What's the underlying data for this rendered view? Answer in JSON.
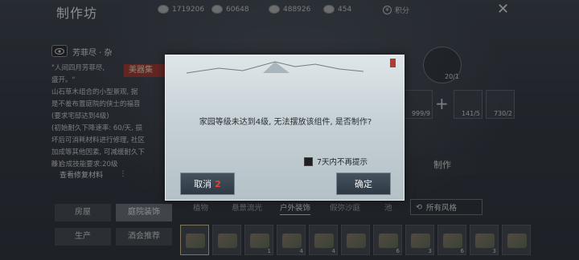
{
  "header": {
    "title": "制作坊",
    "currencies": [
      {
        "icon": "coin-icon",
        "value": "1719206"
      },
      {
        "icon": "stone-icon",
        "value": "60648"
      },
      {
        "icon": "wood-icon",
        "value": "488926"
      },
      {
        "icon": "ore-icon",
        "value": "454"
      }
    ],
    "points_label": "积分",
    "close_icon": "close-icon"
  },
  "item_info": {
    "name": "芳菲尽 · 杂",
    "tag": "美器集",
    "desc": [
      "\"人间四月芳菲尽,",
      "盛开。\"",
      "山石草木组合的小型景观, 据",
      "是不羞布置庭院的侠士的福音",
      "(要求宅邸达到4级)",
      "(初始耐久下降速率: 60/天, 损",
      "坏后可消耗材料进行修理, 社区",
      "加成等其他因素, 可减缓耐久下",
      "降)"
    ],
    "skill_requirement": "◇ 合成技能要求:20级",
    "repair_materials": "查看修复材料"
  },
  "recipe": {
    "product_count": "20/1",
    "materials": [
      {
        "name": "material-1",
        "count": "999/9"
      },
      {
        "name": "material-2",
        "count": "141/5"
      },
      {
        "name": "material-3",
        "count": "730/2"
      }
    ],
    "make_label": "制作"
  },
  "categories": {
    "left_col": [
      "房屋",
      "生产"
    ],
    "right_col": [
      "庭院装饰",
      "酒会推荐"
    ],
    "active": "庭院装饰"
  },
  "subtabs": [
    "植物",
    "悬景流光",
    "户外装饰",
    "假弥沙庭",
    "池"
  ],
  "active_subtab": "户外装饰",
  "filter": {
    "label": "所有风格"
  },
  "grid_counts": [
    "",
    "",
    "1",
    "4",
    "4",
    "",
    "6",
    "3",
    "6",
    "3",
    ""
  ],
  "dialog": {
    "message": "家园等级未达到4级, 无法摆放该组件, 是否制作?",
    "checkbox_label": "7天内不再提示",
    "cancel_label": "取消",
    "cancel_count": "2",
    "confirm_label": "确定"
  }
}
